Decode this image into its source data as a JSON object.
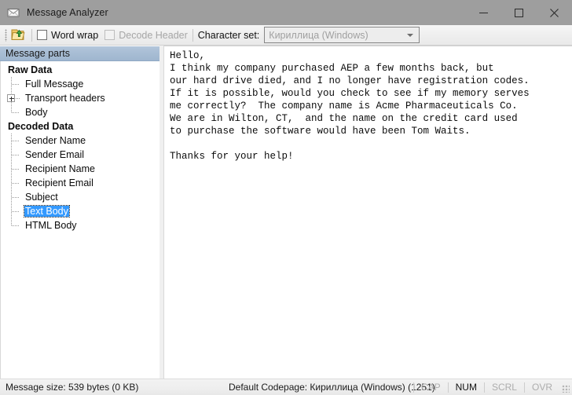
{
  "window": {
    "title": "Message Analyzer",
    "icon": "envelope-icon",
    "minimize_label": "—",
    "maximize_label": "☐",
    "close_label": "✕"
  },
  "toolbar": {
    "open_icon": "open-folder-icon",
    "word_wrap_label": "Word wrap",
    "word_wrap_checked": false,
    "decode_header_label": "Decode Header",
    "decode_header_checked": false,
    "decode_header_disabled": true,
    "charset_label": "Character set:",
    "charset_value": "Кириллица (Windows)",
    "charset_options": [
      "Кириллица (Windows)"
    ]
  },
  "tree": {
    "header": "Message parts",
    "groups": [
      {
        "label": "Raw Data",
        "items": [
          {
            "label": "Full Message",
            "expandable": false,
            "selected": false
          },
          {
            "label": "Transport headers",
            "expandable": true,
            "selected": false
          },
          {
            "label": "Body",
            "expandable": false,
            "selected": false
          }
        ]
      },
      {
        "label": "Decoded Data",
        "items": [
          {
            "label": "Sender Name",
            "expandable": false,
            "selected": false
          },
          {
            "label": "Sender Email",
            "expandable": false,
            "selected": false
          },
          {
            "label": "Recipient Name",
            "expandable": false,
            "selected": false
          },
          {
            "label": "Recipient Email",
            "expandable": false,
            "selected": false
          },
          {
            "label": "Subject",
            "expandable": false,
            "selected": false
          },
          {
            "label": "Text Body",
            "expandable": false,
            "selected": true
          },
          {
            "label": "HTML Body",
            "expandable": false,
            "selected": false
          }
        ]
      }
    ]
  },
  "viewer": {
    "text": "Hello,\nI think my company purchased AEP a few months back, but\nour hard drive died, and I no longer have registration codes.\nIf it is possible, would you check to see if my memory serves\nme correctly?  The company name is Acme Pharmaceuticals Co.\nWe are in Wilton, CT,  and the name on the credit card used\nto purchase the software would have been Tom Waits.\n\nThanks for your help!"
  },
  "statusbar": {
    "message_size": "Message size: 539 bytes (0 KB)",
    "default_codepage": "Default Codepage: Кириллица (Windows) (1251)",
    "flags": [
      {
        "label": "CAP",
        "active": false
      },
      {
        "label": "NUM",
        "active": true
      },
      {
        "label": "SCRL",
        "active": false
      },
      {
        "label": "OVR",
        "active": false
      }
    ]
  },
  "colors": {
    "titlebar": "#9e9e9e",
    "tree_header": "#a7bdd4",
    "selection": "#3399ff",
    "selection_text": "#ffffff",
    "chrome": "#f0f0f0",
    "text": "#0c0c0c",
    "disabled_text": "#a6a6a6"
  }
}
